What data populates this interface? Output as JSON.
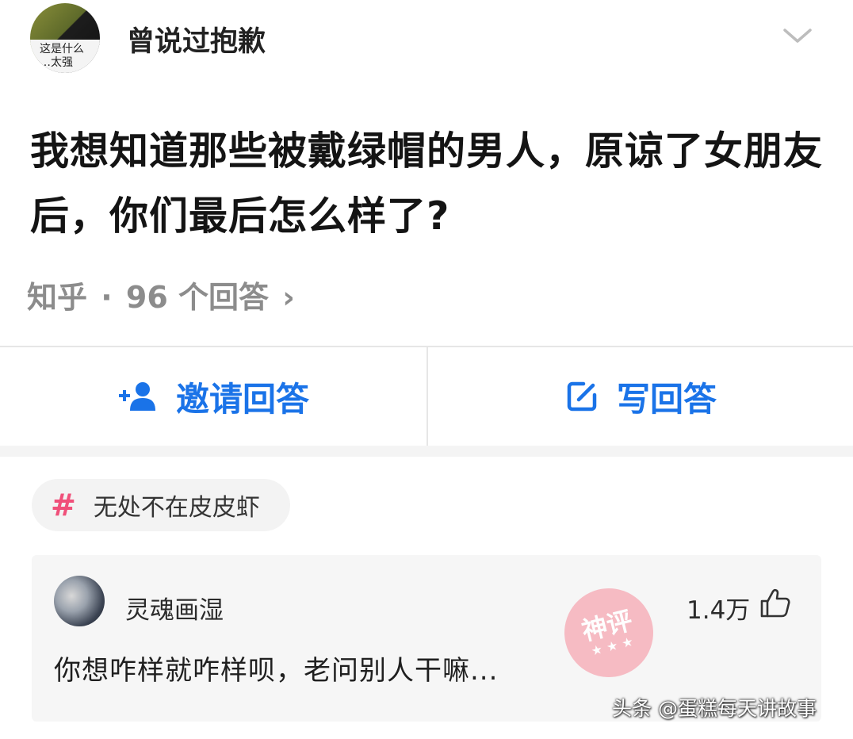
{
  "header": {
    "avatar_caption": "这是什么\n…太强",
    "username": "曾说过抱歉"
  },
  "question": {
    "title": "我想知道那些被戴绿帽的男人，原谅了女朋友后，你们最后怎么样了?",
    "source": "知乎",
    "separator": "·",
    "answer_count": "96 个回答",
    "arrow": "›"
  },
  "actions": {
    "invite_label": "邀请回答",
    "write_label": "写回答"
  },
  "topic": {
    "hash": "#",
    "label": "无处不在皮皮虾"
  },
  "answer": {
    "author": "灵魂画湿",
    "likes": "1.4万",
    "text": "你想咋样就咋样呗，老问别人干嘛..."
  },
  "stamp": {
    "text": "神评",
    "stars": "★ ★ ★"
  },
  "watermark": "头条 @蛋糕每天讲故事",
  "colors": {
    "accent": "#1a73e8",
    "topic_hash": "#f0507a",
    "meta_gray": "#8c8c8c",
    "stamp_pink": "#f6b6bf"
  }
}
